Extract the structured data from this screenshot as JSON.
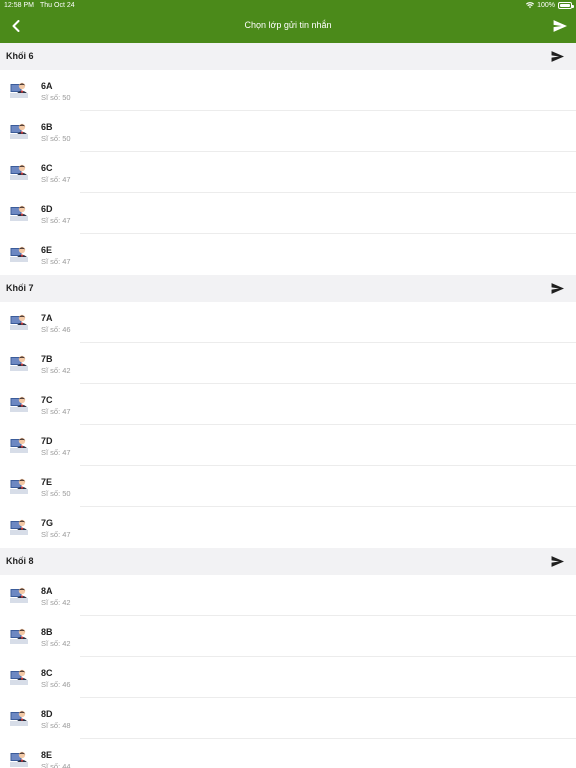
{
  "status": {
    "time": "12:58 PM",
    "date": "Thu Oct 24",
    "battery": "100%"
  },
  "nav": {
    "title": "Chọn lớp gửi tin nhắn"
  },
  "sections": [
    {
      "title": "Khối 6",
      "rows": [
        {
          "name": "6A",
          "count": "Sĩ số: 50"
        },
        {
          "name": "6B",
          "count": "Sĩ số: 50"
        },
        {
          "name": "6C",
          "count": "Sĩ số: 47"
        },
        {
          "name": "6D",
          "count": "Sĩ số: 47"
        },
        {
          "name": "6E",
          "count": "Sĩ số: 47"
        }
      ]
    },
    {
      "title": "Khối 7",
      "rows": [
        {
          "name": "7A",
          "count": "Sĩ số: 46"
        },
        {
          "name": "7B",
          "count": "Sĩ số: 42"
        },
        {
          "name": "7C",
          "count": "Sĩ số: 47"
        },
        {
          "name": "7D",
          "count": "Sĩ số: 47"
        },
        {
          "name": "7E",
          "count": "Sĩ số: 50"
        },
        {
          "name": "7G",
          "count": "Sĩ số: 47"
        }
      ]
    },
    {
      "title": "Khối 8",
      "rows": [
        {
          "name": "8A",
          "count": "Sĩ số: 42"
        },
        {
          "name": "8B",
          "count": "Sĩ số: 42"
        },
        {
          "name": "8C",
          "count": "Sĩ số: 46"
        },
        {
          "name": "8D",
          "count": "Sĩ số: 48"
        },
        {
          "name": "8E",
          "count": "Sĩ số: 44"
        }
      ]
    }
  ],
  "icons": {
    "back": "chevron-left-icon",
    "send": "send-icon",
    "class": "teacher-board-icon"
  },
  "colors": {
    "header": "#4b8a1a",
    "section_bg": "#f2f2f4"
  }
}
